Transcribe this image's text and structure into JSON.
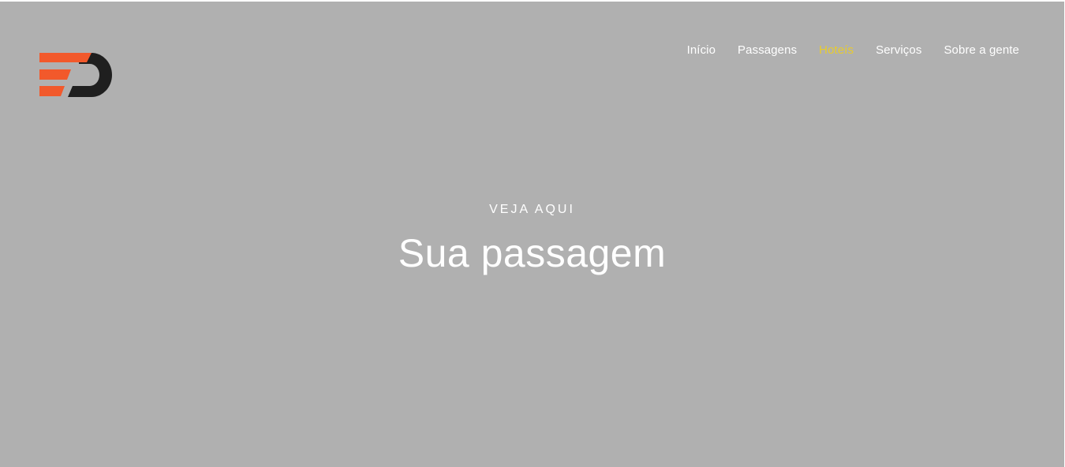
{
  "header": {
    "logo_icon": "ed-logo-icon",
    "nav_items": [
      {
        "label": "Início",
        "active": false
      },
      {
        "label": "Passagens",
        "active": false
      },
      {
        "label": "Hoteís",
        "active": true
      },
      {
        "label": "Serviços",
        "active": false
      },
      {
        "label": "Sobre a gente",
        "active": false
      }
    ]
  },
  "hero": {
    "kicker": "VEJA AQUI",
    "headline": "Sua passagem"
  },
  "colors": {
    "hero_background": "#b0b0b0",
    "logo_orange": "#f2592b",
    "logo_dark": "#1f1f1f",
    "nav_active": "#e8cc2e",
    "text": "#ffffff"
  }
}
